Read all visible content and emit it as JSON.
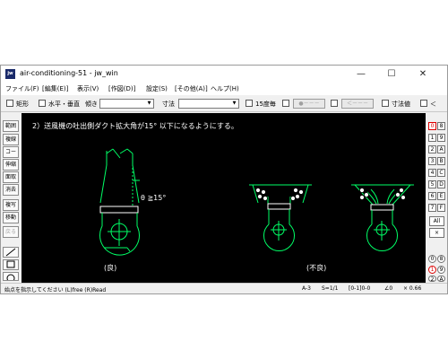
{
  "window": {
    "title": "air-conditioning-51 - jw_win",
    "app_icon": "jw",
    "controls": {
      "minimize": "—",
      "maximize": "☐",
      "close": "✕"
    }
  },
  "menu": [
    "ファイル(F)",
    "[編集(E)]",
    "表示(V)",
    "[作図(D)]",
    "設定(S)",
    "[その他(A)]",
    "ヘルプ(H)"
  ],
  "toolbar": {
    "rect": "矩形",
    "hv": "水平・垂直",
    "tilt": "傾き",
    "dim": "寸法",
    "deg15": "15度毎",
    "btn1": "●－－－",
    "btn2": "＜－－－",
    "dimval": "寸法値",
    "lt": "＜"
  },
  "left_tools": [
    "範囲",
    "複線",
    "コーナー",
    "伸縮",
    "面取",
    "消去",
    "複写",
    "移動",
    "戻る"
  ],
  "left_tools_disabled": [
    "戻る"
  ],
  "right_tools": {
    "col1": [
      "0",
      "1",
      "2",
      "3",
      "4",
      "5",
      "6",
      "7"
    ],
    "col2": [
      "8",
      "9",
      "A",
      "B",
      "C",
      "D",
      "E",
      "F"
    ],
    "all": "All",
    "x": "×",
    "bottom_col1": [
      "0",
      "1",
      "2"
    ],
    "bottom_col2": [
      "8",
      "9",
      "A"
    ]
  },
  "canvas": {
    "heading": "2）送風機の吐出側ダクト拡大角が15° 以下になるようにする。",
    "angle_label": "θ ≧15°",
    "label_good": "(良)",
    "label_bad": "(不良)",
    "colors": {
      "line": "#00ff66",
      "text": "#ffffff",
      "fill": "#ffffff",
      "bg": "#000000"
    }
  },
  "status": {
    "message": "始点を指示してください (L)free (R)Read",
    "scale_a": "A-3",
    "scale_s": "S=1/1",
    "layer": "[0-1]0-0",
    "angle": "∠0",
    "zoom": "× 0.66"
  }
}
